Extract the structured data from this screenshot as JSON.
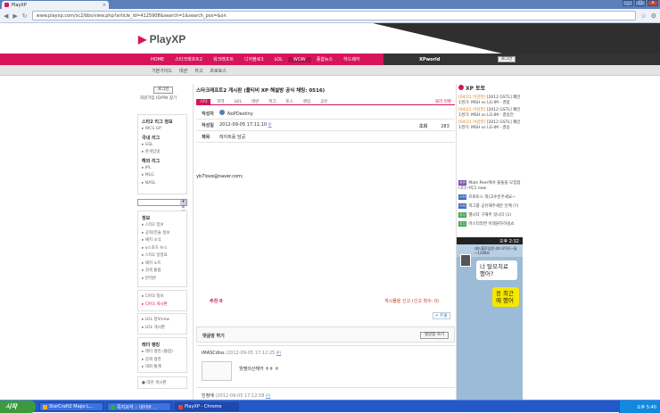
{
  "browser": {
    "tab_title": "PlayXP",
    "url": "www.playxp.com/sc2/bbs/view.php?article_id=4125908&search=1&search_pos=&on",
    "window_controls": {
      "minimize": "_",
      "maximize": "□",
      "close": "x"
    }
  },
  "site": {
    "logo": "PlayXP",
    "main_nav": [
      "HOME",
      "스타크래프트2",
      "워크래프트",
      "디아블로3",
      "LOL",
      "WOW",
      "종합뉴스",
      "하드웨어"
    ],
    "xpworld": "XPworld",
    "login_button": "로그인",
    "sub_nav": [
      "기본가이드",
      "대관",
      "자고",
      "프로토스"
    ]
  },
  "left_sidebar": {
    "login_button": "로그인",
    "join_links": "회원가입  ID/PW 찾기",
    "box1": {
      "heading1": "스타2 리그 정보",
      "items1": [
        "WCS GP"
      ],
      "heading2": "국내 리그",
      "items2": [
        "GSL",
        "온게임넷"
      ],
      "heading3": "해외 리그",
      "items3": [
        "IPL",
        "MLG",
        "NASL"
      ]
    },
    "select": "스포일 방지",
    "box2": {
      "heading": "정보",
      "items": [
        "스타2 정보",
        "공략/전술 정보",
        "패치 소식",
        "e스포츠 뉴스",
        "스타2 일정표",
        "패치 노트",
        "검색 통합",
        "번역본"
      ]
    },
    "box3": {
      "items": [
        "디아3 정보",
        "디아3 게시판"
      ]
    },
    "box4": {
      "items": [
        "LOL 정보new",
        "LOL 게시판"
      ]
    },
    "box5": {
      "heading": "래더 랭킹",
      "items": [
        "래더 랭킹 (통합)",
        "검색 랭킹",
        "대회 통계"
      ]
    },
    "box6": {
      "items": [
        "대한 게시판"
      ]
    }
  },
  "article": {
    "title": "스타크래프트2 게시판 (플티비 XP 해설방 공식 채팅: 0516)",
    "categories": [
      "스타",
      "지역",
      "LOL",
      "테란",
      "저그",
      "토스",
      "랜덤",
      "공유"
    ],
    "recommended": "블라 현황",
    "author_label": "작성자",
    "author": "NoPDestiny",
    "date_label": "작성일",
    "date": "2012-09-05 17:11:10",
    "date_link": "IP",
    "views_label": "조회",
    "views": "283",
    "subject_label": "제목",
    "subject": "레이트를 담공",
    "body": "yb7love@naver.com;",
    "recommend": "추천 0",
    "report": "게시물을 신고 (신고 횟수: 0)",
    "tweet": "트윗",
    "comment_header": "댓글창 하기",
    "comment_button": "댓글창 하기",
    "comments": [
      {
        "user": "iMASCdiss",
        "date": "(2012-09-05 17:12:25",
        "link": "IP)",
        "text": "뭣땜의산해카 ㅎㅎ ㅎ"
      },
      {
        "user": "민정애",
        "date": "(2012-09-05 17:12:58",
        "link": "IP)",
        "text": "어 라"
      }
    ]
  },
  "right_sidebar": {
    "title": "XP 토토",
    "toto": [
      {
        "tag": "[04/21 마감한]",
        "text": "[2012 GSTL] 폐인 1경기: MSH vs LG-IM - 경합"
      },
      {
        "tag": "[04/21 마감한]",
        "text": "[2012 GSTL] 폐인 1경기: MSH vs LG-IM - 결승전"
      },
      {
        "tag": "[04/21 마감한]",
        "text": "[2012 GSTL] 폐인 1경기: MSH vs LG-IM - 결승"
      }
    ],
    "posts": [
      {
        "tag": "자유",
        "color": "pur",
        "text": "Male Peer에서 울돌을 모집합니다~버그 new"
      },
      {
        "tag": "스타",
        "color": "blu",
        "text": "프로토스 뭐(고수분주세요~"
      },
      {
        "tag": "스타",
        "color": "blu",
        "text": "저그를 공유해주세분 인께 (?)"
      },
      {
        "tag": "잡담",
        "color": "grn",
        "text": "별나다 구해주 있니다 (1)"
      },
      {
        "tag": "잡담",
        "color": "grn",
        "text": "마스터라면 아레원하하실쇼"
      }
    ]
  },
  "phone": {
    "time": "오후 2:32",
    "header": "레드블로섬퀸 레드로직1~돌~1308요",
    "msg1": "너 탈모치료 했어?",
    "msg2": "응 최근에 했어"
  },
  "taskbar": {
    "start": "시작",
    "items": [
      "StarCraft2 Maps L...",
      "쪽지요약 :: 네이버 ...",
      "PlayXP - Chrome"
    ],
    "time": "오후 5:40"
  }
}
